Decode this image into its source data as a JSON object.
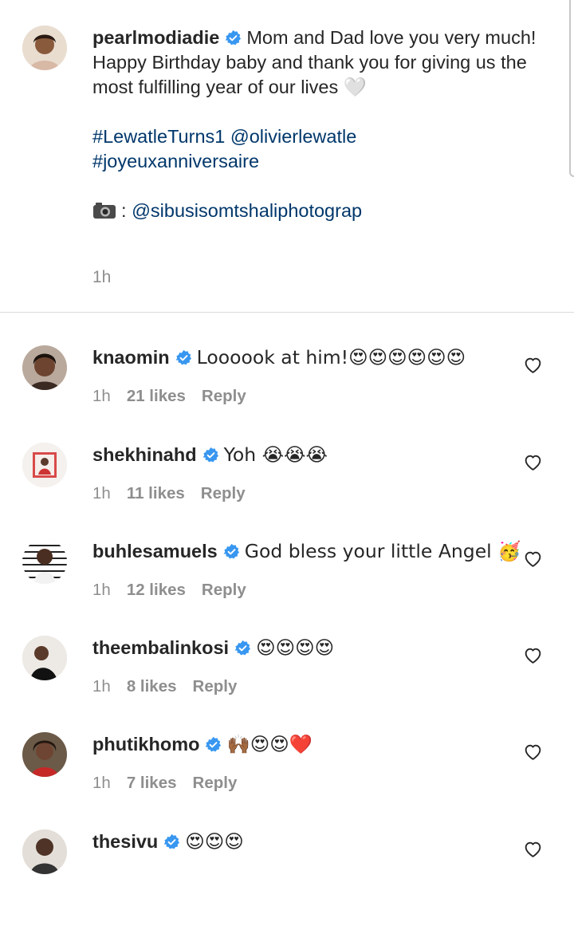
{
  "caption": {
    "username": "pearlmodiadie",
    "text_line1": "Mom and Dad love you very much!",
    "text_line2": "Happy Birthday baby and thank you for giving us the most fulfilling year of our lives",
    "heart_emoji": "🤍",
    "hashtag1": "#LewatleTurns1",
    "mention1": "@olivierlewatle",
    "hashtag2": "#joyeuxanniversaire",
    "photo_prefix": ":",
    "photo_credit": "@sibusisomtshaliphotograp",
    "time": "1h"
  },
  "comments": [
    {
      "username": "knaomin",
      "text": "Loooook at him!😍😍😍😍😍😍",
      "time": "1h",
      "likes": "21 likes",
      "reply": "Reply"
    },
    {
      "username": "shekhinahd",
      "text": "Yoh 😭😭😭",
      "time": "1h",
      "likes": "11 likes",
      "reply": "Reply"
    },
    {
      "username": "buhlesamuels",
      "text": "God bless your little Angel 🥳",
      "time": "1h",
      "likes": "12 likes",
      "reply": "Reply"
    },
    {
      "username": "theembalinkosi",
      "text": "😍😍😍😍",
      "time": "1h",
      "likes": "8 likes",
      "reply": "Reply"
    },
    {
      "username": "phutikhomo",
      "text": "🙌🏾😍😍❤️",
      "time": "1h",
      "likes": "7 likes",
      "reply": "Reply"
    },
    {
      "username": "thesivu",
      "text": "😍😍😍",
      "time": "",
      "likes": "",
      "reply": ""
    }
  ],
  "colors": {
    "verified": "#3897f0",
    "link": "#00376b",
    "meta": "#8e8e8e"
  }
}
